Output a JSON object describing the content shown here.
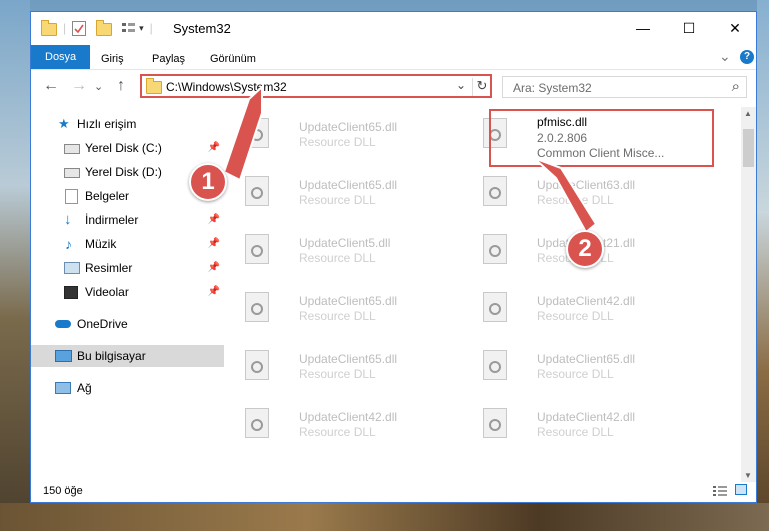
{
  "window": {
    "title": "System32",
    "minimize": "—",
    "maximize": "☐",
    "close": "✕"
  },
  "ribbon": {
    "tabs": [
      "Dosya",
      "Giriş",
      "Paylaş",
      "Görünüm"
    ],
    "expand": "⌄",
    "help": "?"
  },
  "nav": {
    "back": "←",
    "forward": "→",
    "recent": "⌄",
    "up": "↑",
    "address": "C:\\Windows\\System32",
    "address_dropdown": "⌄",
    "refresh": "↻",
    "search_placeholder": "Ara: System32",
    "search_icon": "⌕"
  },
  "sidebar": {
    "quick_access": "Hızlı erişim",
    "items": [
      {
        "label": "Yerel Disk (C:)",
        "icon": "drive-icon",
        "pinned": true
      },
      {
        "label": "Yerel Disk (D:)",
        "icon": "drive-icon",
        "pinned": false
      },
      {
        "label": "Belgeler",
        "icon": "documents-icon",
        "pinned": true
      },
      {
        "label": "İndirmeler",
        "icon": "downloads-icon",
        "pinned": true
      },
      {
        "label": "Müzik",
        "icon": "music-icon",
        "pinned": true
      },
      {
        "label": "Resimler",
        "icon": "pictures-icon",
        "pinned": true
      },
      {
        "label": "Videolar",
        "icon": "videos-icon",
        "pinned": true
      }
    ],
    "onedrive": "OneDrive",
    "this_pc": "Bu bilgisayar",
    "network": "Ağ",
    "pin_glyph": "📌"
  },
  "files": {
    "left": [
      {
        "name": "UpdateClient65.dll",
        "desc": "Resource DLL"
      },
      {
        "name": "UpdateClient65.dll",
        "desc": "Resource DLL"
      },
      {
        "name": "UpdateClient5.dll",
        "desc": "Resource DLL"
      },
      {
        "name": "UpdateClient65.dll",
        "desc": "Resource DLL"
      },
      {
        "name": "UpdateClient65.dll",
        "desc": "Resource DLL"
      },
      {
        "name": "UpdateClient42.dll",
        "desc": "Resource DLL"
      }
    ],
    "right": [
      {
        "name": "pfmisc.dll",
        "version": "2.0.2.806",
        "desc": "Common Client Misce..."
      },
      {
        "name": "UpdateClient63.dll",
        "desc": "Resource DLL"
      },
      {
        "name": "UpdateClient21.dll",
        "desc": "Resource DLL"
      },
      {
        "name": "UpdateClient42.dll",
        "desc": "Resource DLL"
      },
      {
        "name": "UpdateClient65.dll",
        "desc": "Resource DLL"
      },
      {
        "name": "UpdateClient42.dll",
        "desc": "Resource DLL"
      }
    ]
  },
  "status": {
    "count": "150 öğe"
  },
  "callouts": {
    "one": "1",
    "two": "2"
  },
  "colors": {
    "accent": "#1979ca",
    "highlight": "#d9534f"
  }
}
